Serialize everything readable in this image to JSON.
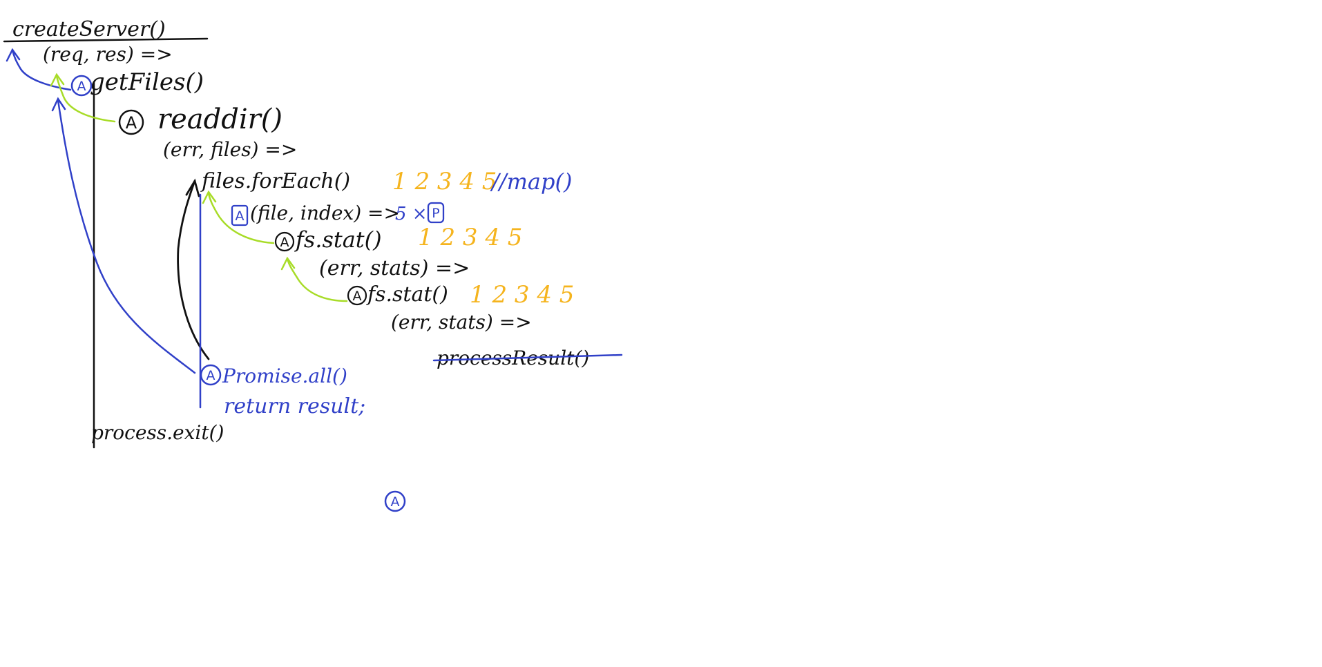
{
  "colors": {
    "ink": "#111111",
    "blue": "#3040c8",
    "green": "#a8dc28",
    "orange": "#f5b41e",
    "background": "#ffffff"
  },
  "labels": {
    "create_server": "createServer()",
    "req_res": "(req, res) =>",
    "get_files": "getFiles()",
    "read_dir": "readdir()",
    "err_files": "(err, files) =>",
    "files_foreach": "files.forEach()",
    "numbers_1": "1 2 3 4 5",
    "map_note": "//map()",
    "file_index": "(file, index) =>",
    "five_times": "5 ×",
    "p_badge": "P",
    "fs_stat_1": "fs.stat()",
    "numbers_2": "1 2 3 4 5",
    "err_stats_1": "(err, stats) =>",
    "fs_stat_2": "fs.stat()",
    "numbers_3": "1 2 3 4 5",
    "err_stats_2": "(err, stats) =>",
    "process_result": "processResult()",
    "promise_all": "Promise.all()",
    "return_result": "return result;",
    "process_exit": "process.exit()",
    "a_badge": "A"
  }
}
